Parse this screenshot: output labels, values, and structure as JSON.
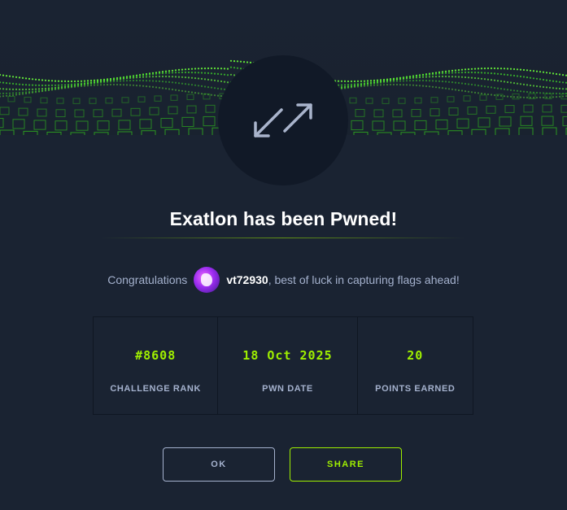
{
  "header": {
    "badge_icon": "expand-arrows-icon"
  },
  "title": "Exatlon has been Pwned!",
  "congrats": {
    "prefix": "Congratulations",
    "username": "vt72930",
    "suffix": ", best of luck in capturing flags ahead!"
  },
  "stats": [
    {
      "value": "#8608",
      "label": "CHALLENGE RANK"
    },
    {
      "value": "18 Oct 2025",
      "label": "PWN DATE"
    },
    {
      "value": "20",
      "label": "POINTS EARNED"
    }
  ],
  "buttons": {
    "ok": "OK",
    "share": "SHARE"
  },
  "colors": {
    "background": "#1a2332",
    "accent": "#9fef00",
    "muted_text": "#a4b1cd"
  }
}
